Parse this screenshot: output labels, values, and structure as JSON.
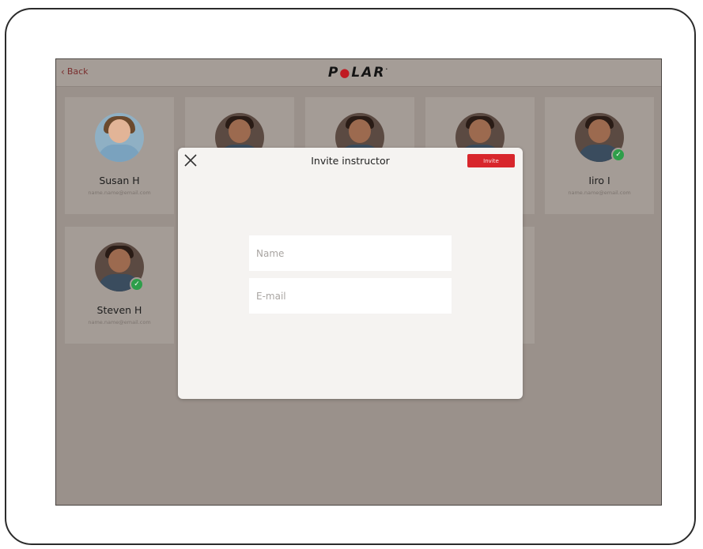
{
  "header": {
    "back_label": "Back",
    "logo_text": "POLAR"
  },
  "instructors": [
    {
      "name": "Susan H",
      "email": "name.name@email.com",
      "verified": false
    },
    {
      "name": "",
      "email": "",
      "verified": false
    },
    {
      "name": "",
      "email": "",
      "verified": false
    },
    {
      "name": "",
      "email": "",
      "verified": false
    },
    {
      "name": "Iiro I",
      "email": "name.name@email.com",
      "verified": true
    },
    {
      "name": "Steven H",
      "email": "name.name@email.com",
      "verified": true
    }
  ],
  "modal": {
    "title": "Invite instructor",
    "invite_label": "Invite",
    "name_placeholder": "Name",
    "email_placeholder": "E-mail",
    "name_value": "",
    "email_value": ""
  },
  "icons": {
    "close": "close-icon",
    "back": "chevron-left-icon",
    "verified": "check-circle-icon"
  },
  "colors": {
    "accent": "#d8262c",
    "verified": "#2e9e4a",
    "overlay": "#9a918b"
  }
}
